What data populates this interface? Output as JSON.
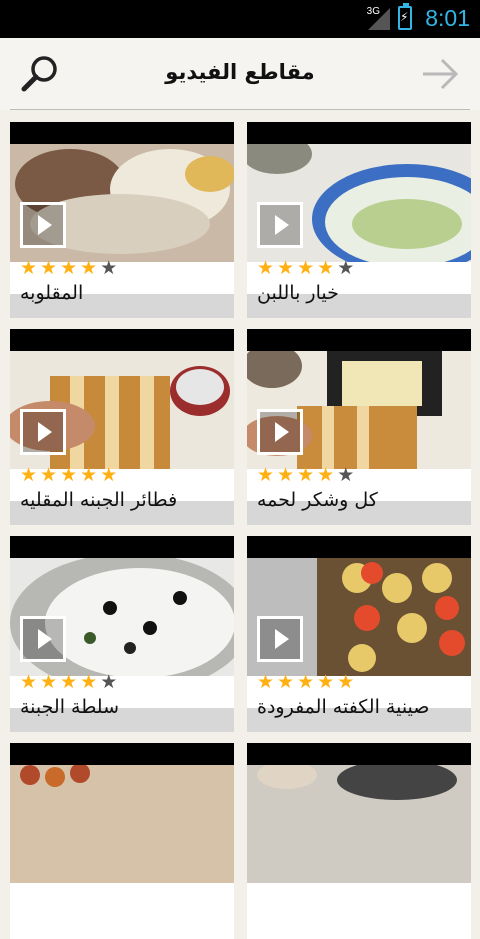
{
  "status": {
    "network": "3G",
    "time": "8:01"
  },
  "header": {
    "title": "مقاطع الفيديو"
  },
  "videos": [
    {
      "title": "المقلوبه",
      "rating": 4
    },
    {
      "title": "خيار باللبن",
      "rating": 4
    },
    {
      "title": "فطائر الجبنه المقليه",
      "rating": 5
    },
    {
      "title": "كل وشكر لحمه",
      "rating": 4
    },
    {
      "title": "سلطة الجبنة",
      "rating": 4
    },
    {
      "title": "صينية الكفته المفرودة",
      "rating": 5
    },
    {
      "title": "",
      "rating": 0
    },
    {
      "title": "",
      "rating": 0
    }
  ],
  "colors": {
    "accent": "#33b5e5",
    "star": "#ffb012",
    "star_empty": "#555555"
  }
}
